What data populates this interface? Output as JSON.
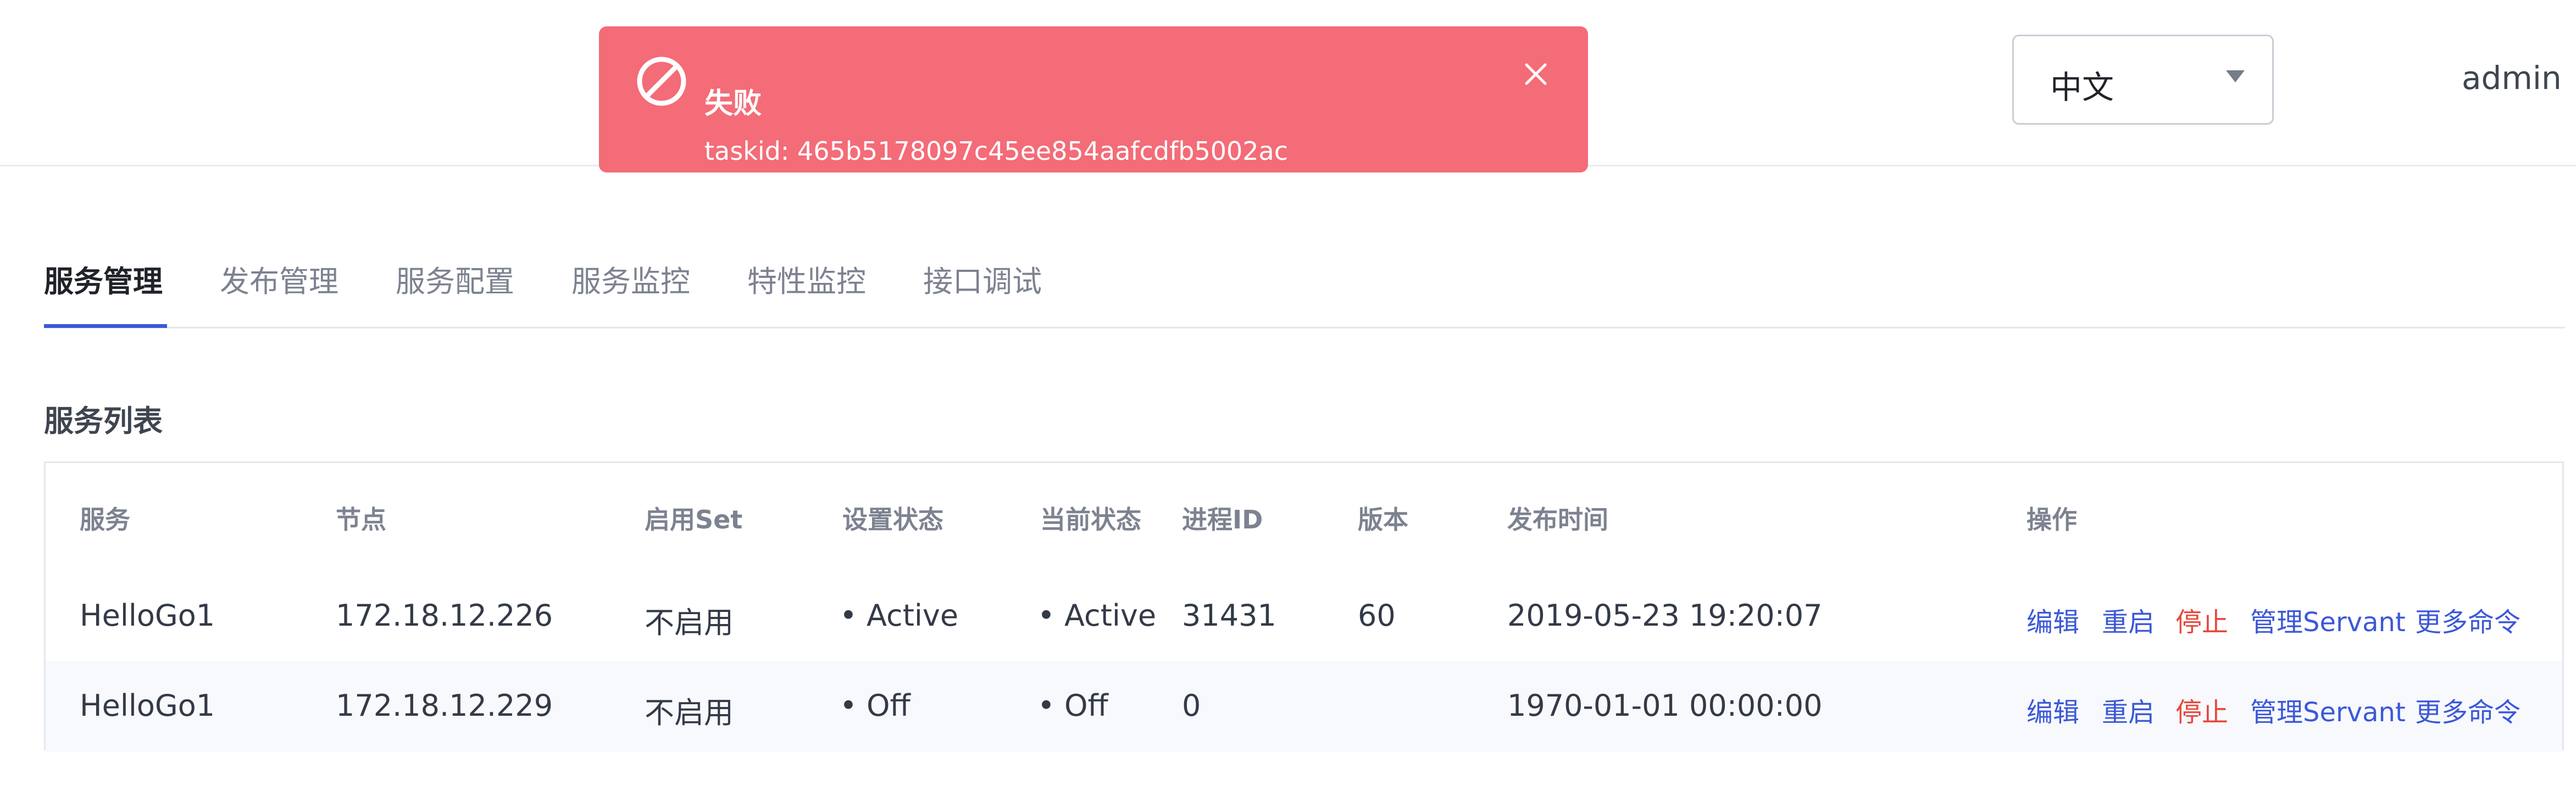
{
  "header": {
    "language": "中文",
    "user": "admin"
  },
  "toast": {
    "title": "失败",
    "message": "taskid: 465b5178097c45ee854aafcdfb5002ac",
    "type": "error",
    "color": "#f36c78"
  },
  "tabs": [
    {
      "label": "服务管理",
      "active": true
    },
    {
      "label": "发布管理",
      "active": false
    },
    {
      "label": "服务配置",
      "active": false
    },
    {
      "label": "服务监控",
      "active": false
    },
    {
      "label": "特性监控",
      "active": false
    },
    {
      "label": "接口调试",
      "active": false
    }
  ],
  "section_title": "服务列表",
  "table": {
    "columns": [
      "服务",
      "节点",
      "启用Set",
      "设置状态",
      "当前状态",
      "进程ID",
      "版本",
      "发布时间",
      "操作"
    ],
    "rows": [
      {
        "service": "HelloGo1",
        "node": "172.18.12.226",
        "set": "不启用",
        "setting_status": "• Active",
        "current_status": "• Active",
        "pid": "31431",
        "version": "60",
        "publish_time": "2019-05-23 19:20:07"
      },
      {
        "service": "HelloGo1",
        "node": "172.18.12.229",
        "set": "不启用",
        "setting_status": "• Off",
        "current_status": "• Off",
        "pid": "0",
        "version": "",
        "publish_time": "1970-01-01 00:00:00"
      }
    ],
    "actions": {
      "edit": "编辑",
      "restart": "重启",
      "stop": "停止",
      "servant": "管理Servant",
      "more": "更多命令"
    }
  },
  "colors": {
    "accent": "#3c58d8",
    "active_status": "#2ec07a",
    "off_status": "#e8483c"
  },
  "icons": {
    "toast_icon": "ban-icon",
    "toast_close": "close-icon",
    "select_caret": "caret-down-icon"
  }
}
